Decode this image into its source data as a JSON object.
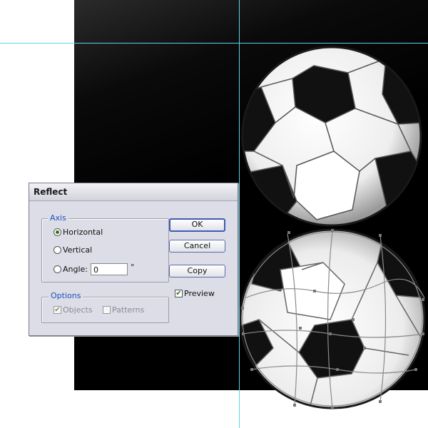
{
  "dialog": {
    "title": "Reflect",
    "axis_group_label": "Axis",
    "axis_options": [
      {
        "label": "Horizontal",
        "selected": true
      },
      {
        "label": "Vertical",
        "selected": false
      },
      {
        "label": "Angle:",
        "selected": false
      }
    ],
    "angle_value": "0",
    "degree_symbol": "°",
    "options_group_label": "Options",
    "objects_label": "Objects",
    "objects_checked": true,
    "patterns_label": "Patterns",
    "patterns_checked": false,
    "ok_label": "OK",
    "cancel_label": "Cancel",
    "copy_label": "Copy",
    "preview_label": "Preview",
    "preview_checked": true
  },
  "colors": {
    "guide": "#5fd3e8",
    "artboard": "#000000",
    "accent": "#1f4fbf"
  }
}
